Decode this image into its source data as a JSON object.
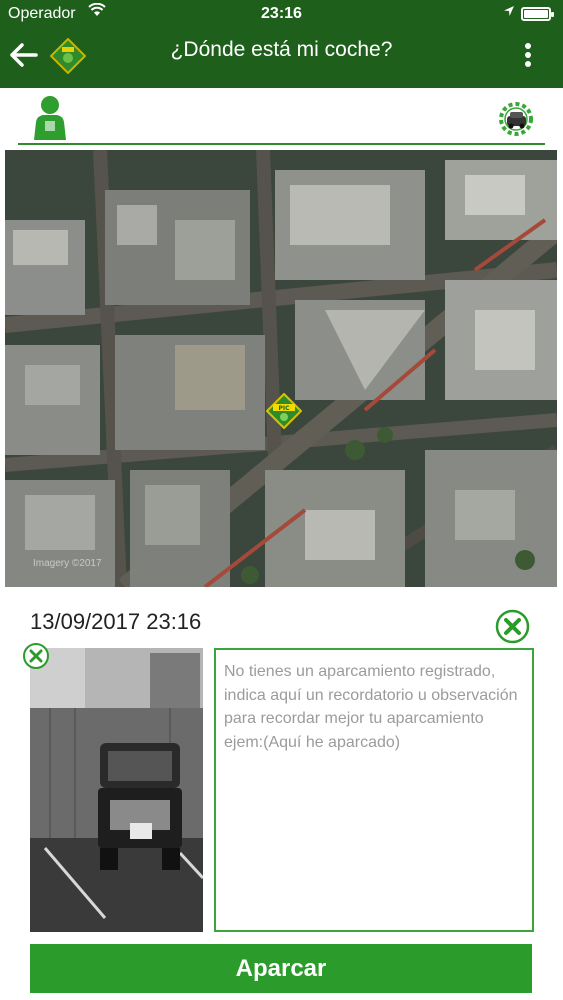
{
  "status_bar": {
    "carrier": "Operador",
    "time": "23:16"
  },
  "app_bar": {
    "back_icon": "back-arrow-icon",
    "logo_icon": "app-logo-icon",
    "title": "¿Dónde está mi coche?",
    "menu_icon": "more-vert-icon"
  },
  "tabs": {
    "left_icon": "person-icon",
    "right_icon": "gear-car-icon"
  },
  "map": {
    "marker_icon": "parking-marker-icon",
    "marker_label": "PIC",
    "attribution": "Imagery ©2017"
  },
  "parking": {
    "datetime": "13/09/2017 23:16",
    "note_text": "No tienes un aparcamiento registrado, indica aquí un recordatorio u observación para recordar mejor tu aparcamiento ejem:(Aquí he aparcado)",
    "photo_icon": "car-photo",
    "clear_icon": "close-circle-icon",
    "remove_photo_icon": "close-circle-icon"
  },
  "actions": {
    "park_label": "Aparcar"
  },
  "colors": {
    "header": "#1f5f1c",
    "accent": "#2b9b2b",
    "border": "#3aa63a"
  }
}
